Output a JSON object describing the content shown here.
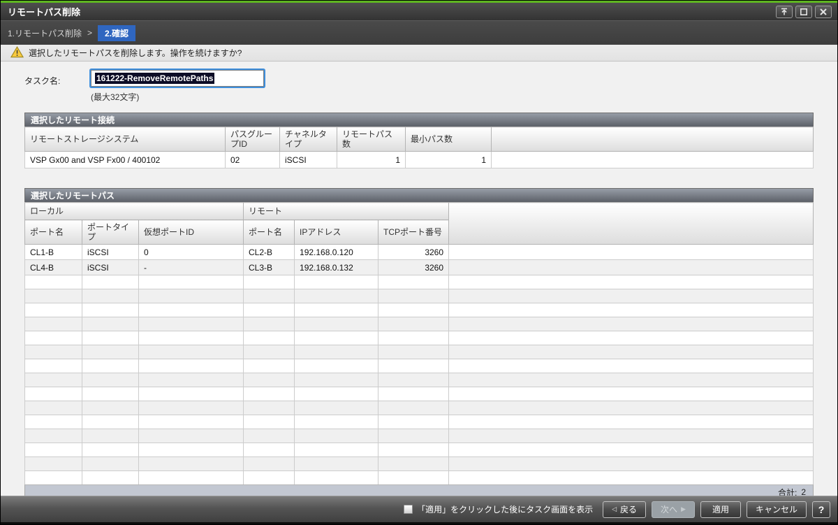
{
  "window": {
    "title": "リモートパス削除"
  },
  "breadcrumb": {
    "step1": "1.リモートパス削除",
    "separator": ">",
    "step2": "2.確認"
  },
  "warning": {
    "message": "選択したリモートパスを削除します。操作を続けますか?"
  },
  "task": {
    "label": "タスク名:",
    "value": "161222-RemoveRemotePaths",
    "hint": "(最大32文字)"
  },
  "remote_connections": {
    "title": "選択したリモート接続",
    "columns": [
      "リモートストレージシステム",
      "パスグループID",
      "チャネルタイプ",
      "リモートパス数",
      "最小パス数"
    ],
    "row": {
      "storage_system": "VSP Gx00 and VSP Fx00 / 400102",
      "path_group_id": "02",
      "channel_type": "iSCSI",
      "remote_path_count": "1",
      "min_path_count": "1"
    }
  },
  "remote_paths": {
    "title": "選択したリモートパス",
    "groups": {
      "local": "ローカル",
      "remote": "リモート"
    },
    "columns": {
      "local_port": "ポート名",
      "port_type": "ポートタイプ",
      "virtual_port_id": "仮想ポートID",
      "remote_port": "ポート名",
      "ip_address": "IPアドレス",
      "tcp_port": "TCPポート番号"
    },
    "rows": [
      {
        "local_port": "CL1-B",
        "port_type": "iSCSI",
        "virtual_port_id": "0",
        "remote_port": "CL2-B",
        "ip_address": "192.168.0.120",
        "tcp_port": "3260"
      },
      {
        "local_port": "CL4-B",
        "port_type": "iSCSI",
        "virtual_port_id": "-",
        "remote_port": "CL3-B",
        "ip_address": "192.168.0.132",
        "tcp_port": "3260"
      }
    ],
    "empty_row_count": 15,
    "total_label": "合計:",
    "total_value": "2"
  },
  "toolbar": {
    "checkbox_label": "「適用」をクリックした後にタスク画面を表示",
    "back_label": "戻る",
    "back_icon": "◁",
    "next_label": "次へ",
    "next_icon": "▶",
    "apply_label": "適用",
    "cancel_label": "キャンセル",
    "help_label": "?"
  },
  "icons": {
    "titlebar": [
      "detach-icon",
      "maximize-icon",
      "close-icon"
    ],
    "warning": "warning-triangle-icon",
    "back": "left-triangle-icon",
    "next": "right-triangle-icon",
    "help": "question-mark-icon"
  },
  "colors": {
    "accent_green": "#5fb621",
    "step_badge_blue": "#2f66c0",
    "selection_bg": "#0c0c26",
    "table_footer": "#c3c8d2",
    "warning_yellow": "#f8c93d",
    "warning_border": "#a08a24"
  }
}
